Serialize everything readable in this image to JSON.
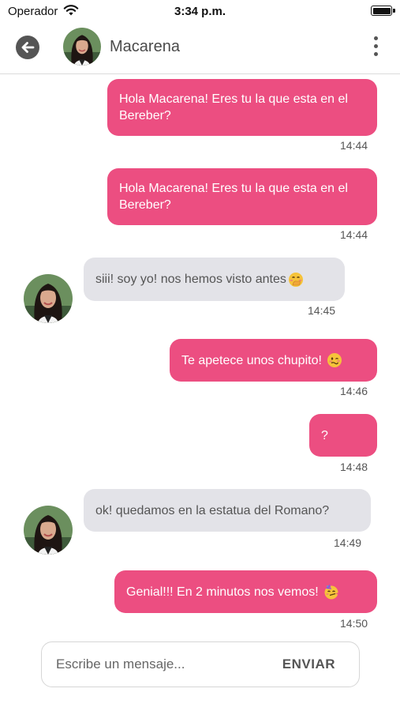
{
  "status_bar": {
    "carrier": "Operador",
    "time": "3:34 p.m."
  },
  "header": {
    "contact_name": "Macarena",
    "back_icon": "arrow-left-circle-icon",
    "menu_icon": "more-vertical-icon"
  },
  "messages": [
    {
      "direction": "out",
      "text": "Hola Macarena! Eres tu la que esta en el Bereber?",
      "time": "14:44"
    },
    {
      "direction": "out",
      "text": "Hola Macarena! Eres tu la que esta en el Bereber?",
      "time": "14:44"
    },
    {
      "direction": "in",
      "text": "siii! soy yo! nos hemos visto antes",
      "emoji": "face-with-hand-over-mouth",
      "time": "14:45"
    },
    {
      "direction": "out",
      "text": "Te apetece unos chupito!",
      "emoji": "woozy-face",
      "time": "14:46"
    },
    {
      "direction": "out",
      "text": "?",
      "time": "14:48"
    },
    {
      "direction": "in",
      "text": "ok! quedamos en la estatua del Romano?",
      "time": "14:49"
    },
    {
      "direction": "out",
      "text": "Genial!!! En 2 minutos nos vemos!",
      "emoji": "partying-face",
      "time": "14:50"
    }
  ],
  "composer": {
    "placeholder": "Escribe un mensaje...",
    "value": "",
    "send_label": "ENVIAR"
  },
  "colors": {
    "outgoing_bubble": "#ec4e81",
    "incoming_bubble": "#e3e3e8"
  }
}
